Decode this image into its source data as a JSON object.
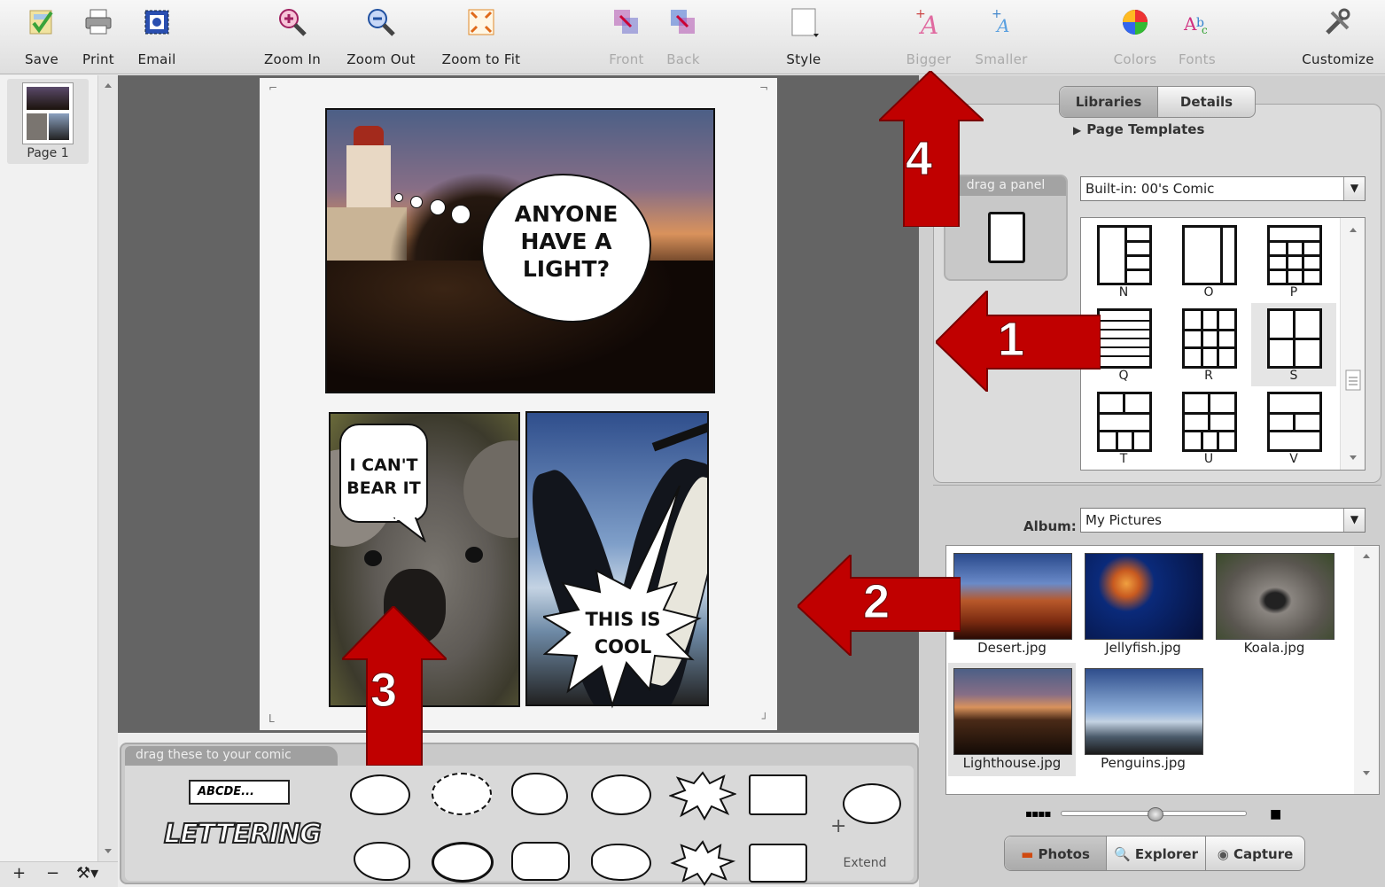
{
  "toolbar": {
    "save": "Save",
    "print": "Print",
    "email": "Email",
    "zoom_in": "Zoom In",
    "zoom_out": "Zoom Out",
    "zoom_fit": "Zoom to Fit",
    "front": "Front",
    "back": "Back",
    "style": "Style",
    "bigger": "Bigger",
    "smaller": "Smaller",
    "colors": "Colors",
    "fonts": "Fonts",
    "customize": "Customize"
  },
  "pages": {
    "thumb_label": "Page 1",
    "add": "+",
    "remove": "−",
    "tools": "⚒▾"
  },
  "comic": {
    "bubble_1": [
      "ANYONE",
      "HAVE A",
      "LIGHT?"
    ],
    "bubble_2": [
      "I CAN'T",
      "BEAR IT"
    ],
    "bubble_3": [
      "THIS IS",
      "COOL"
    ]
  },
  "tray": {
    "tab": "drag these to your comic",
    "caption_sample": "ABCDE...",
    "lettering": "LETTERING",
    "extend": "Extend"
  },
  "right": {
    "tab_libraries": "Libraries",
    "tab_details": "Details",
    "page_templates": "Page Templates",
    "template_select": "Built-in: 00's Comic",
    "drag_panel": "drag a panel",
    "templates": [
      "N",
      "O",
      "P",
      "Q",
      "R",
      "S",
      "T",
      "U",
      "V"
    ],
    "selected_template": "S",
    "album_label": "Album:",
    "album_select": "My Pictures",
    "photos": [
      "Desert.jpg",
      "Jellyfish.jpg",
      "Koala.jpg",
      "Lighthouse.jpg",
      "Penguins.jpg"
    ],
    "selected_photo": "Lighthouse.jpg",
    "source_tabs": {
      "photos": "Photos",
      "explorer": "Explorer",
      "capture": "Capture"
    }
  },
  "annotations": {
    "a1": "1",
    "a2": "2",
    "a3": "3",
    "a4": "4",
    "color": "#c00000"
  }
}
